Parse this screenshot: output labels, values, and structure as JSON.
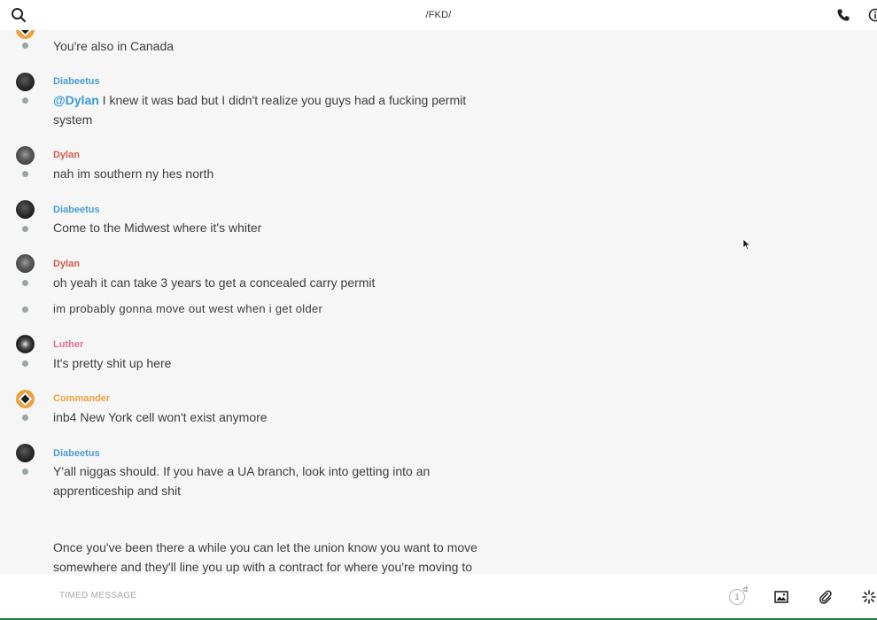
{
  "header": {
    "title": "/FKD/"
  },
  "messages": [
    {
      "sender": "",
      "text": "You're also in Canada"
    },
    {
      "sender": "Diabeetus",
      "mention": "@Dylan",
      "text": " I knew it was bad but I didn't realize you guys had a fucking permit system"
    },
    {
      "sender": "Dylan",
      "text": "nah im southern ny hes north"
    },
    {
      "sender": "Diabeetus",
      "text": "Come to the Midwest where it's whiter"
    },
    {
      "sender": "Dylan",
      "text": "oh yeah it can take 3 years to get a concealed carry permit"
    },
    {
      "sender": "",
      "text": "im probably gonna move out west when i get older"
    },
    {
      "sender": "Luther",
      "text": "It's pretty shit up here"
    },
    {
      "sender": "Commander",
      "text": "inb4 New York cell won't exist anymore"
    },
    {
      "sender": "Diabeetus",
      "text": "Y'all niggas should. If you have a UA branch, look into getting into an apprenticeship and shit"
    },
    {
      "sender": "",
      "text": "Once you've been there a while you can let the union know you want to move somewhere and they'll line you up with a contract for where you're moving to"
    }
  ],
  "composer": {
    "placeholder": "TIMED MESSAGE",
    "timer_value": "1",
    "timer_unit": "d"
  },
  "colors": {
    "Diabeetus": "#4a9fd3",
    "Dylan": "#d85a4e",
    "Luther": "#e0709a",
    "Commander": "#f0a23a",
    "mention": "#3a9ad9"
  },
  "icons": [
    "search-icon",
    "phone-icon",
    "info-icon",
    "timer-icon",
    "image-icon",
    "paperclip-icon",
    "sparkle-icon"
  ]
}
